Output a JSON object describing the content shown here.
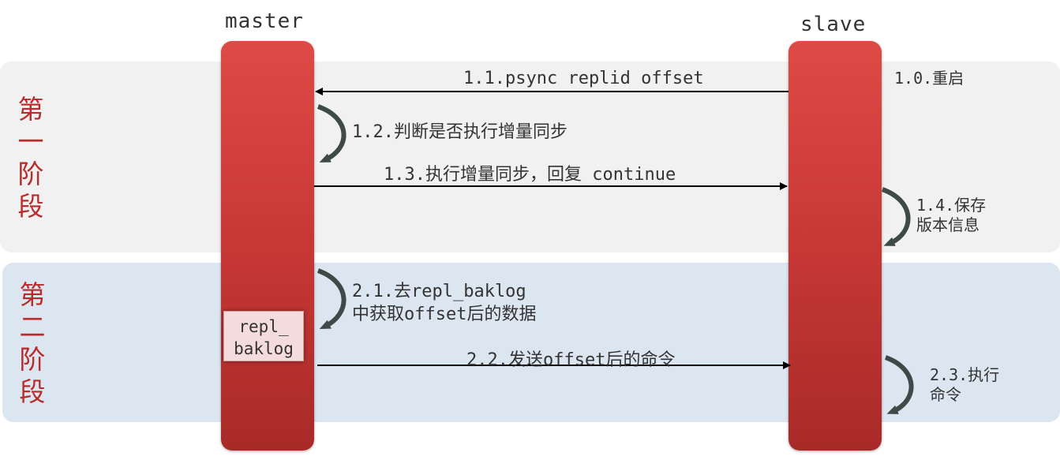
{
  "phases": [
    {
      "chars": [
        "第",
        "一",
        "阶",
        "段"
      ]
    },
    {
      "chars": [
        "第",
        "二",
        "阶",
        "段"
      ]
    }
  ],
  "actors": {
    "master": "master",
    "slave": "slave"
  },
  "baklog": {
    "line1": "repl_",
    "line2": "baklog"
  },
  "messages": {
    "m1_1": "1.1.psync replid offset",
    "m1_3": "1.3.执行增量同步，回复 continue",
    "m2_2": "2.2.发送offset后的命令"
  },
  "notes": {
    "n1_0": "1.0.重启",
    "n1_2": "1.2.判断是否执行增量同步",
    "n1_4": [
      "1.4.保存",
      "版本信息"
    ],
    "n2_1": [
      "2.1.去repl_baklog",
      "中获取offset后的数据"
    ],
    "n2_3": [
      "2.3.执行",
      "命令"
    ]
  },
  "colors": {
    "lifeline": "#c73835",
    "phase_text": "#b82c2c",
    "band1": "#f1f1f1",
    "band2": "#dce6f1",
    "self_arrow": "#3d4a47"
  }
}
